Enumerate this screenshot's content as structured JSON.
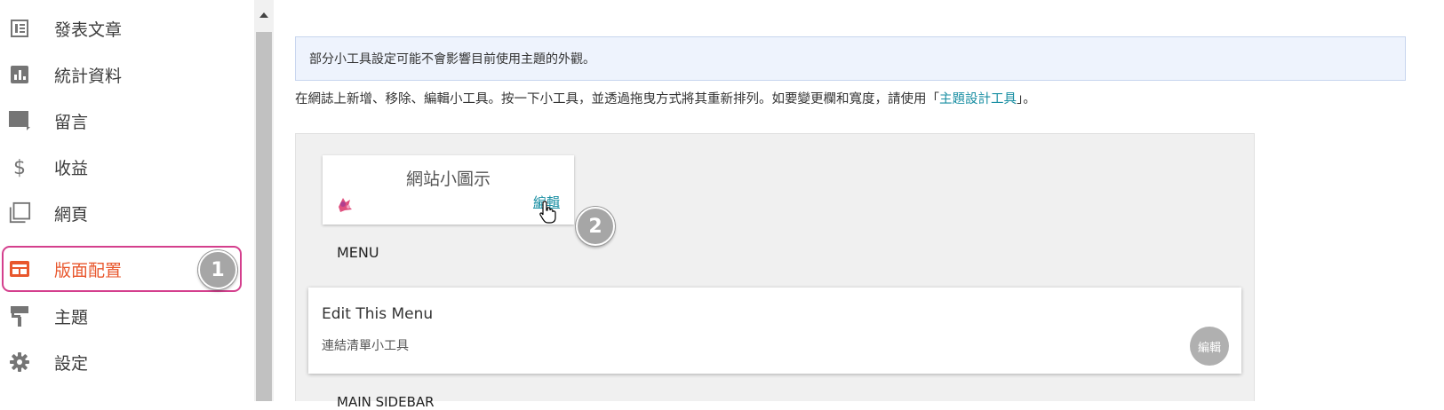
{
  "sidebar": {
    "items": [
      {
        "label": "發表文章",
        "icon": "posts-icon"
      },
      {
        "label": "統計資料",
        "icon": "stats-icon"
      },
      {
        "label": "留言",
        "icon": "comments-icon"
      },
      {
        "label": "收益",
        "icon": "earnings-icon"
      },
      {
        "label": "網頁",
        "icon": "pages-icon"
      },
      {
        "label": "版面配置",
        "icon": "layout-icon",
        "active": true
      },
      {
        "label": "主題",
        "icon": "theme-icon"
      },
      {
        "label": "設定",
        "icon": "settings-icon"
      }
    ],
    "active_color": "#e8572d"
  },
  "badges": {
    "step1": "1",
    "step2": "2"
  },
  "notice": {
    "text": "部分小工具設定可能不會影響目前使用主題的外觀。"
  },
  "intro": {
    "text_before": "在網誌上新增、移除、編輯小工具。按一下小工具，並透過拖曳方式將其重新排列。如要變更欄和寬度，請使用「",
    "link": "主題設計工具",
    "text_after": "」。"
  },
  "favicon_widget": {
    "title": "網站小圖示",
    "edit_label": "編輯"
  },
  "menu_section": {
    "label": "MENU",
    "widget": {
      "title": "Edit This Menu",
      "subtitle": "連結清單小工具",
      "edit_label": "編輯"
    }
  },
  "next_section": {
    "label": "MAIN SIDEBAR"
  }
}
